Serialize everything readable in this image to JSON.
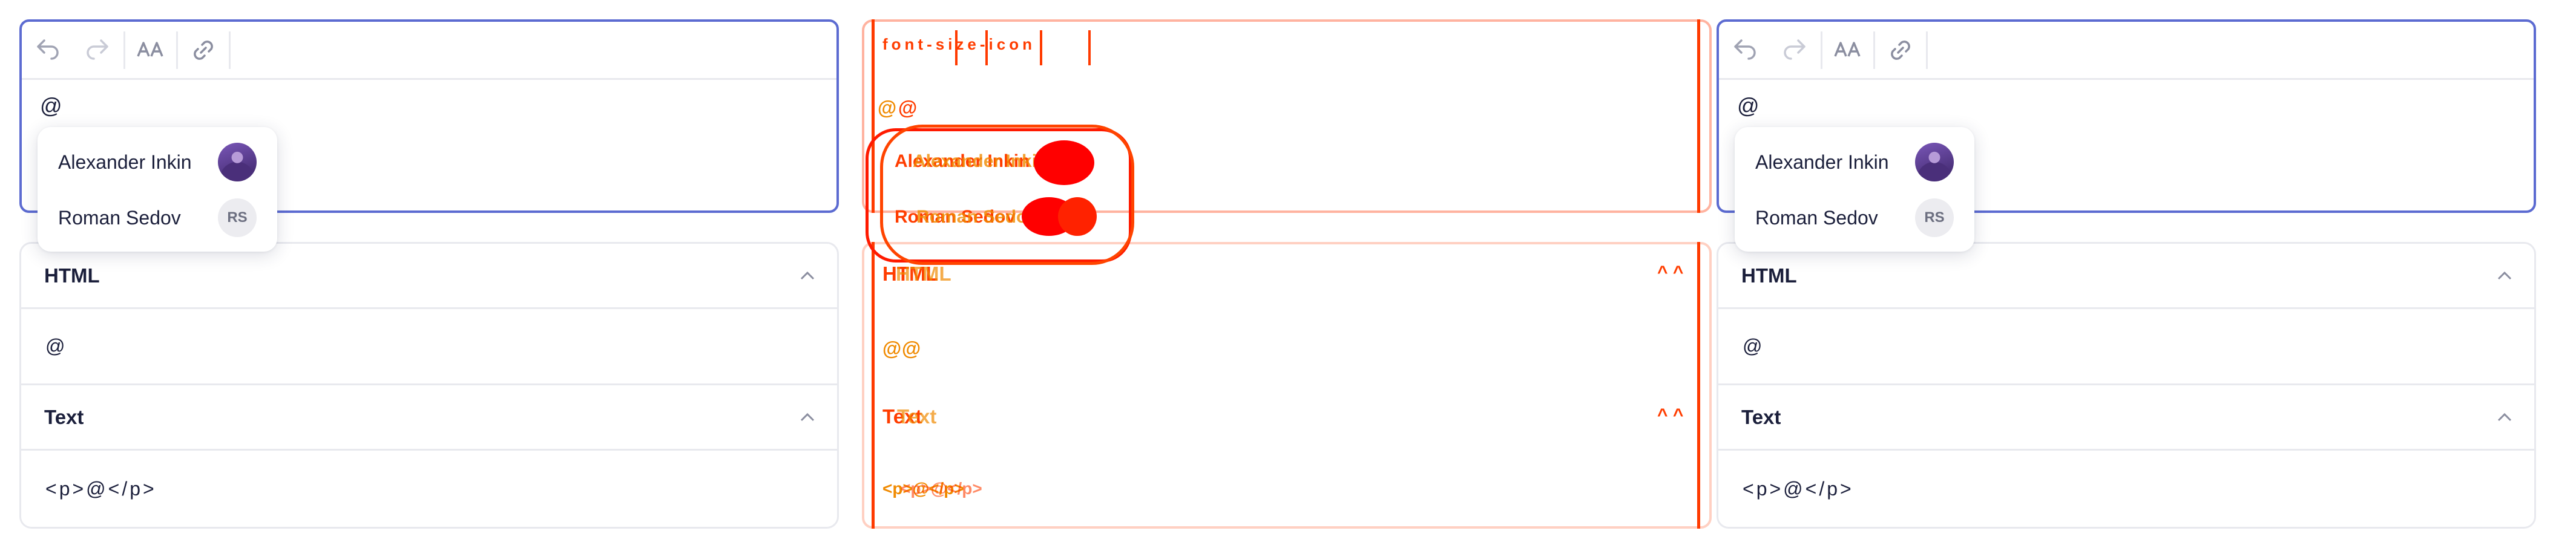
{
  "editor": {
    "toolbar": {
      "undo_icon": "undo-icon",
      "redo_icon": "redo-icon",
      "font_icon": "font-size-icon",
      "link_icon": "link-icon"
    },
    "content": "@"
  },
  "mentions": [
    {
      "name": "Alexander Inkin",
      "avatar": "photo"
    },
    {
      "name": "Roman Sedov",
      "avatar": "initials",
      "initials": "RS"
    }
  ],
  "accordion": {
    "html": {
      "title": "HTML",
      "value": "@"
    },
    "text": {
      "title": "Text",
      "value": "<p>@</p>"
    }
  },
  "colors": {
    "accent": "#5c6bd1",
    "border": "#e8e9ee",
    "text": "#1b1f3b",
    "diff": "#ff3a00"
  }
}
